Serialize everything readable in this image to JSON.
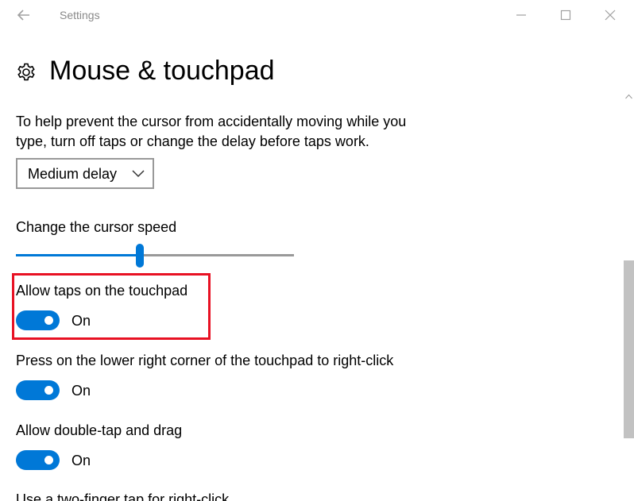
{
  "window": {
    "title": "Settings",
    "back_icon": "back-arrow-icon",
    "minimize_icon": "minimize-icon",
    "maximize_icon": "maximize-icon",
    "close_icon": "close-icon"
  },
  "header": {
    "icon": "gear-icon",
    "title": "Mouse & touchpad"
  },
  "touchpad_delay": {
    "description": "To help prevent the cursor from accidentally moving while you type, turn off taps or change the delay before taps work.",
    "selected_value": "Medium delay"
  },
  "cursor_speed": {
    "label": "Change the cursor speed",
    "value_fraction": 0.446
  },
  "settings": [
    {
      "label": "Allow taps on the touchpad",
      "state": "On",
      "on": true
    },
    {
      "label": "Press on the lower right corner of the touchpad to right-click",
      "state": "On",
      "on": true
    },
    {
      "label": "Allow double-tap and drag",
      "state": "On",
      "on": true
    }
  ],
  "next_setting_label": "Use a two-finger tap for right-click",
  "colors": {
    "accent": "#0078d7",
    "highlight": "#e81123"
  }
}
